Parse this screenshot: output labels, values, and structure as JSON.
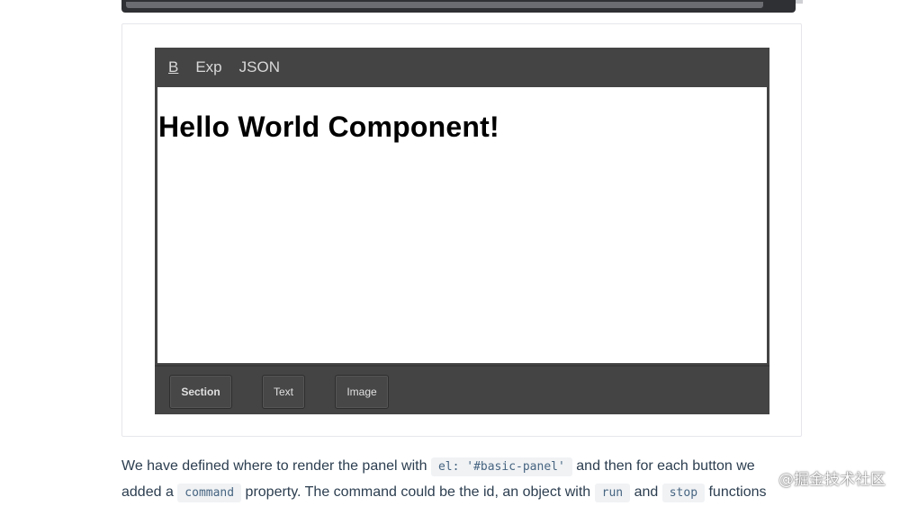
{
  "editor": {
    "toolbar": {
      "bold_label": "B",
      "export_label": "Exp",
      "json_label": "JSON"
    },
    "canvas": {
      "heading": "Hello World Component!"
    },
    "blocks": [
      {
        "label": "Section"
      },
      {
        "label": "Text"
      },
      {
        "label": "Image"
      }
    ]
  },
  "paragraph": {
    "line1_a": "We have defined where to render the panel with",
    "code_el": "el: '#basic-panel'",
    "line1_b": "and then for each button we",
    "line2_a": "added a",
    "code_command": "command",
    "line2_b": "property. The command could be the id, an object with",
    "code_run": "run",
    "line2_c": "and",
    "code_stop": "stop",
    "line2_d": "functions"
  },
  "watermark": "@掘金技术社区",
  "colors": {
    "editor_bg": "#444444",
    "toolbar_text": "#d8d8d8",
    "body_text": "#2c3e50",
    "code_bg": "#f0f2f4",
    "code_text": "#476582"
  }
}
